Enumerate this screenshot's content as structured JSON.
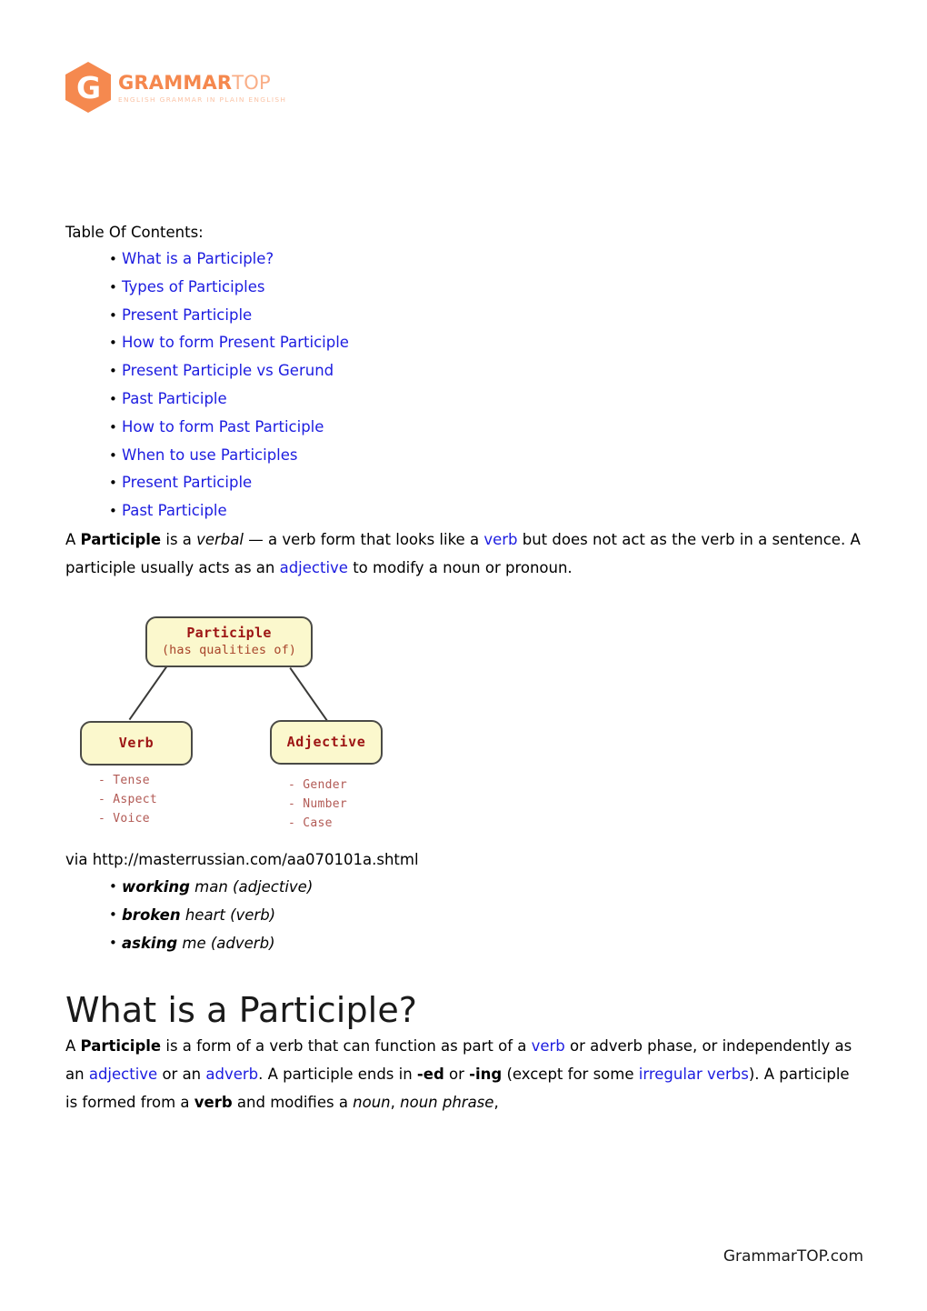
{
  "logo": {
    "hex_letter": "G",
    "word_strong": "GRAMMAR",
    "word_light": "TOP",
    "tagline": "ENGLISH GRAMMAR IN PLAIN ENGLISH",
    "hex_color": "#f5894f",
    "word_strong_color": "#f5884e",
    "word_light_color": "#f9ae87"
  },
  "toc": {
    "title": "Table Of Contents:",
    "items": [
      "What is a Participle?",
      "Types of Participles",
      "Present Participle",
      "How to form Present Participle",
      "Present Participle vs Gerund",
      "Past Participle",
      "How to form Past Participle",
      "When to use Participles",
      "Present Participle",
      "Past Participle"
    ],
    "link_color": "#1c1ce0"
  },
  "intro_paragraph": {
    "t1": "A ",
    "b1": "Participle",
    "t2": " is a ",
    "i1": "verbal",
    "t3": " — a verb form that looks like a ",
    "l1": "verb",
    "t4": " but does not act as the verb in a sentence. A participle usually acts as an ",
    "l2": "adjective",
    "t5": " to modify a noun or pronoun."
  },
  "diagram": {
    "top_title": "Participle",
    "top_subtitle": "(has qualities of)",
    "left_label": "Verb",
    "right_label": "Adjective",
    "left_attributes": "- Tense\n- Aspect\n- Voice",
    "right_attributes": "- Gender\n- Number\n- Case",
    "box_fill": "#fbf8cd",
    "box_border": "#4a4a46",
    "title_color": "#9d1414",
    "attribute_color": "#b25a55"
  },
  "via_line": "via http://masterrussian.com/aa070101a.shtml",
  "examples": [
    {
      "bold": "working",
      "rest": " man (adjective)"
    },
    {
      "bold": "broken",
      "rest": " heart (verb)"
    },
    {
      "bold": "asking",
      "rest": " me (adverb)"
    }
  ],
  "heading": "What is a Participle?",
  "body_paragraph": {
    "t1": "A ",
    "b1": "Participle",
    "t2": " is a form of a verb that can function as part of a ",
    "l1": "verb",
    "t3": " or adverb phase, or independently as an ",
    "l2": "adjective",
    "t4": " or an ",
    "l3": "adverb",
    "t5": ". A participle ends in ",
    "b2": "-ed",
    "t6": " or ",
    "b3": "-ing",
    "t7": " (except for some ",
    "l4": "irregular verbs",
    "t8": "). A participle is formed from a ",
    "b4": "verb",
    "t9": " and modifies a ",
    "i1": "noun",
    "t10": ", ",
    "i2": "noun phrase",
    "t11": ","
  },
  "footer": "GrammarTOP.com"
}
